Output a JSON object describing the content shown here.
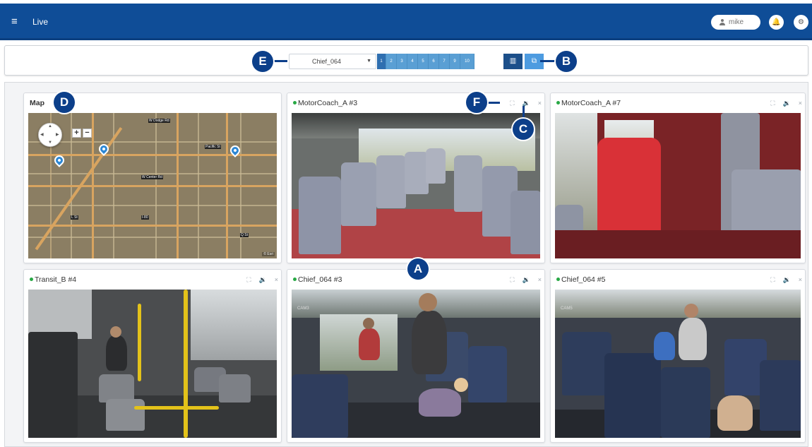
{
  "topbar": {
    "title": "Live",
    "menu_icon": "hamburger-icon",
    "user": "mike",
    "bell_icon": "bell-icon",
    "settings_icon": "gears-icon",
    "color": "#0f4d97"
  },
  "toolbar": {
    "vehicle_select": "Chief_064",
    "pages": [
      "1",
      "2",
      "3",
      "4",
      "5",
      "6",
      "7",
      "9",
      "10"
    ],
    "map_icon": "map-icon",
    "external_icon": "external-link-icon"
  },
  "tiles": [
    {
      "title": "Map",
      "type": "map"
    },
    {
      "title": "MotorCoach_A #3",
      "status": "online"
    },
    {
      "title": "MotorCoach_A #7",
      "status": "online"
    },
    {
      "title": "Transit_B #4",
      "status": "online"
    },
    {
      "title": "Chief_064 #3",
      "status": "online"
    },
    {
      "title": "Chief_064 #5",
      "status": "online"
    }
  ],
  "tile_controls": {
    "expand": "⛶",
    "audio": "🔉",
    "close": "×"
  },
  "map": {
    "labels": [
      "W Dodge Rd",
      "W Center Rd",
      "Pacific St",
      "L St",
      "I-80",
      "Q St"
    ],
    "attribution": "© Esri"
  },
  "feeds": {
    "chief3_tag": "CAM3",
    "chief5_tag": "CAM5"
  },
  "callouts": [
    "A",
    "B",
    "C",
    "D",
    "E",
    "F"
  ]
}
